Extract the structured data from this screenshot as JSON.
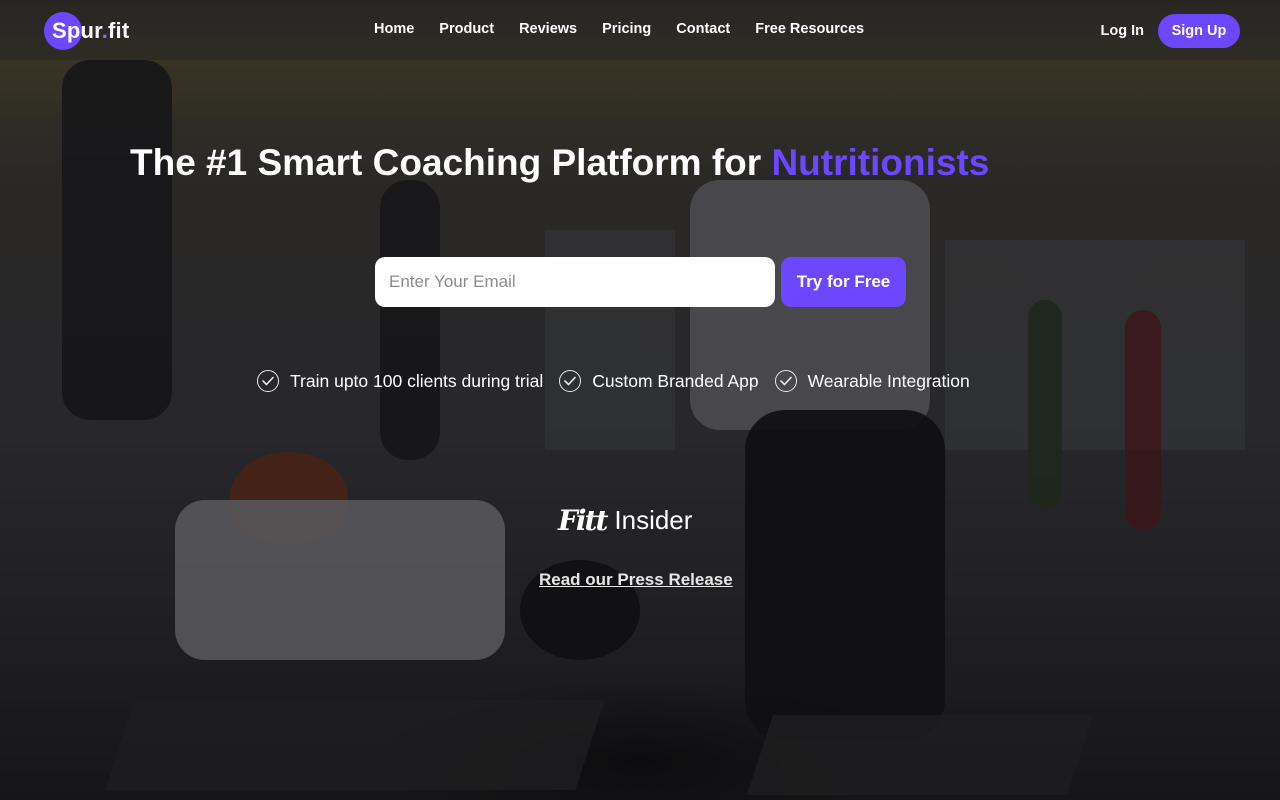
{
  "brand": {
    "name_primary": "Spur",
    "name_dot": ".",
    "name_secondary": "fit",
    "accent_color": "#6c47ff"
  },
  "nav": {
    "items": [
      {
        "label": "Home"
      },
      {
        "label": "Product"
      },
      {
        "label": "Reviews"
      },
      {
        "label": "Pricing"
      },
      {
        "label": "Contact"
      },
      {
        "label": "Free Resources"
      }
    ]
  },
  "auth": {
    "login_label": "Log In",
    "signup_label": "Sign Up"
  },
  "hero": {
    "title_main": "The #1 Smart Coaching Platform for ",
    "title_accent": "Nutritionists",
    "email_placeholder": "Enter Your Email",
    "email_value": "",
    "cta_label": "Try for Free"
  },
  "features": [
    {
      "label": "Train upto 100 clients during trial",
      "icon": "check-circle-icon"
    },
    {
      "label": "Custom Branded App",
      "icon": "check-circle-icon"
    },
    {
      "label": "Wearable Integration",
      "icon": "check-circle-icon"
    }
  ],
  "press": {
    "logo_mark": "Fitt",
    "logo_name": "Insider",
    "link_label": "Read our Press Release"
  }
}
